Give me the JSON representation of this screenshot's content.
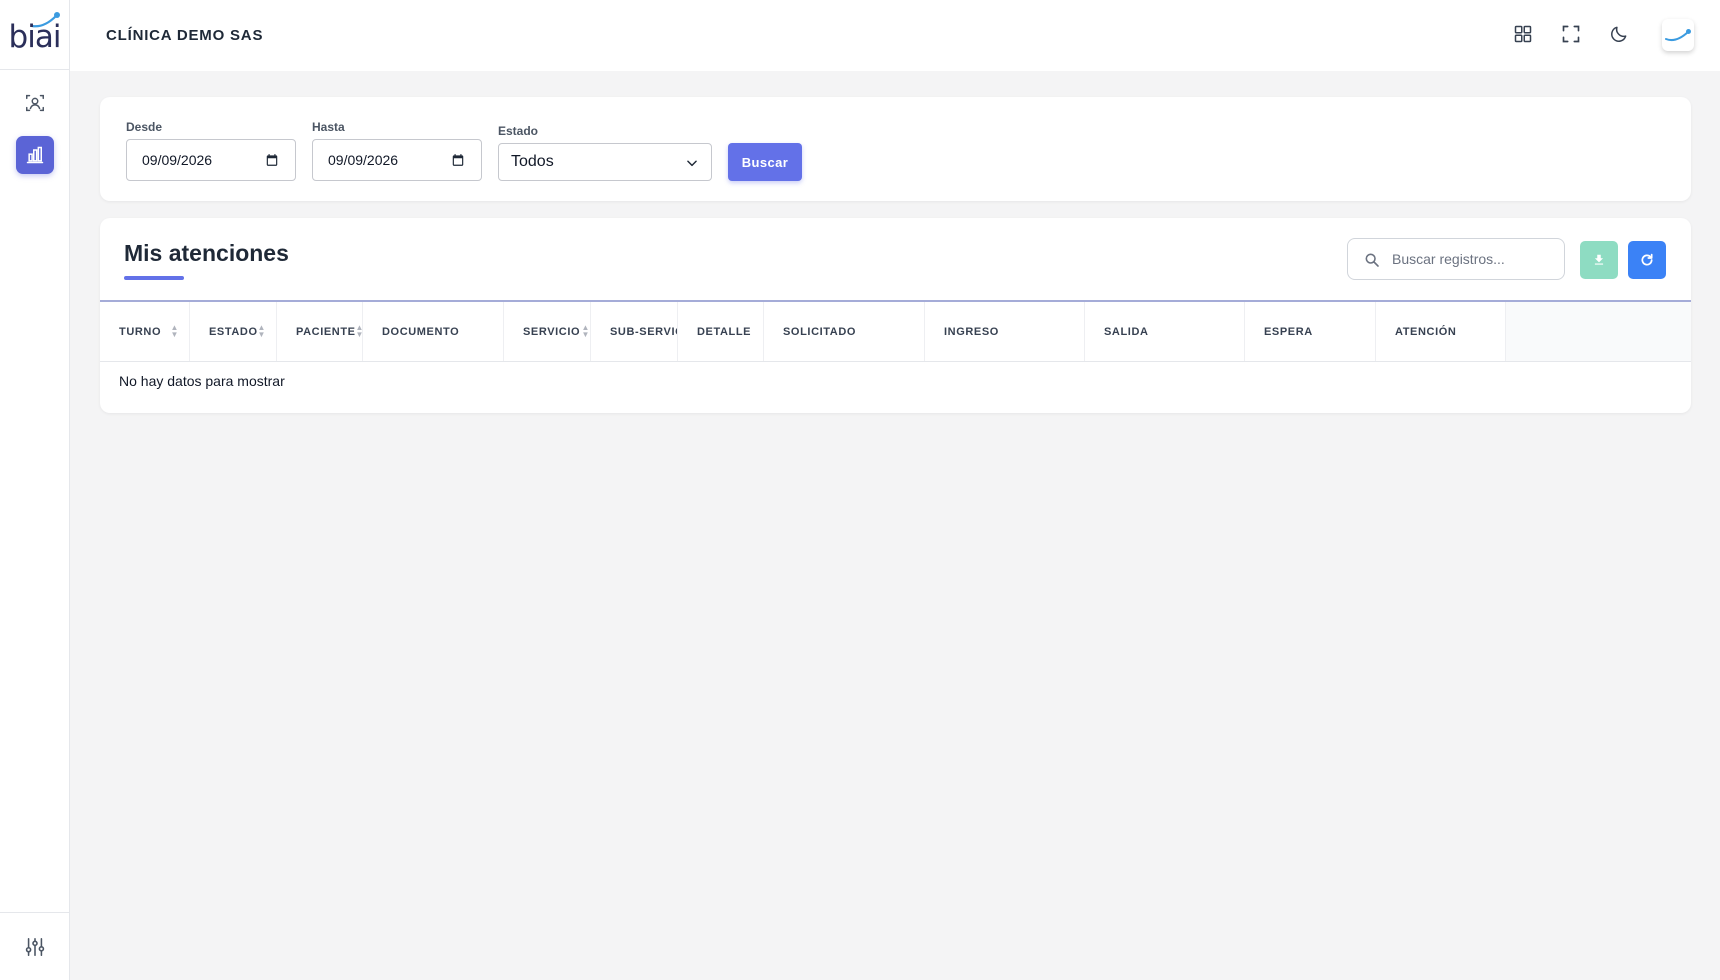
{
  "app": {
    "logo_text": "biai"
  },
  "header": {
    "title": "CLÍNICA DEMO SAS"
  },
  "sidebar": {
    "items": [
      {
        "name": "user-scan",
        "icon": "user-scan-icon",
        "active": false
      },
      {
        "name": "reports",
        "icon": "bar-chart-icon",
        "active": true
      }
    ],
    "bottom_icon": "sliders-icon"
  },
  "filters": {
    "desde_label": "Desde",
    "desde_value": "09/09/2026",
    "hasta_label": "Hasta",
    "hasta_value": "09/09/2026",
    "estado_label": "Estado",
    "estado_value": "Todos",
    "buscar_label": "Buscar"
  },
  "table": {
    "title": "Mis atenciones",
    "search_placeholder": "Buscar registros...",
    "columns": [
      "TURNO",
      "ESTADO",
      "PACIENTE",
      "DOCUMENTO",
      "SERVICIO",
      "SUB-SERVICIO",
      "DETALLE",
      "SOLICITADO",
      "INGRESO",
      "SALIDA",
      "ESPERA",
      "ATENCIÓN"
    ],
    "empty_message": "No hay datos para mostrar"
  },
  "colors": {
    "accent": "#6371e8",
    "sidebar_active": "#5b64d6",
    "download": "#8edcc2",
    "refresh": "#3b82f6"
  }
}
